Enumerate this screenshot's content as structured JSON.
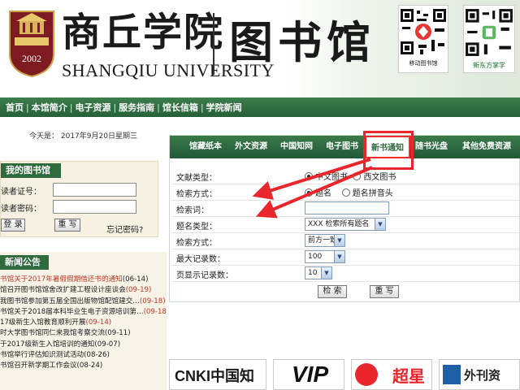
{
  "header": {
    "university_cn": "商丘学院",
    "university_en": "SHANGQIU UNIVERSITY",
    "library_cn": "图书馆",
    "crest_year": "2002",
    "qr1_caption": "移动图书馆",
    "qr2_caption": "新东方掌学"
  },
  "nav": {
    "items": [
      "首页",
      "本馆简介",
      "电子资源",
      "服务指南",
      "馆长信箱",
      "学院新闻"
    ]
  },
  "today": "今天是： 2017年9月20日星期三",
  "my_library": {
    "title": "我的图书馆",
    "reader_id_label": "读者证号：",
    "reader_pwd_label": "读者密码：",
    "login_button": "登 录",
    "reset_button": "重 写",
    "forgot_link": "忘记密码?"
  },
  "news": {
    "title": "新闻公告",
    "items": [
      {
        "title": "书馆关于2017年暑假假期借还书的通知",
        "date": "(06-14)"
      },
      {
        "title": "馆召开图书馆馆舍改扩建工程设计座谈会",
        "date": "(09-19)"
      },
      {
        "title": "我图书馆参加第五届全国出版物馆配馆建交…",
        "date": "(09-18)"
      },
      {
        "title": "书馆关于2018届本科毕业生电子资源培训第…",
        "date": "(09-18)"
      },
      {
        "title": "17级新生入馆教育顺利开展",
        "date": "(09-14)"
      },
      {
        "title": "时大学图书馆同仁来我馆考察交流",
        "date": "(09-11)"
      },
      {
        "title": "于2017级新生入馆培训的通知",
        "date": "(09-07)"
      },
      {
        "title": "书馆举行评估知识测试活动",
        "date": "(08-26)"
      },
      {
        "title": "书馆召开新学期工作会议",
        "date": "(08-24)"
      }
    ]
  },
  "search": {
    "tabs": [
      "馆藏纸本",
      "外文资源",
      "中国知网",
      "电子图书",
      "新书通知",
      "随书光盘",
      "其他免费资源"
    ],
    "active_tab": "新书通知",
    "rows": {
      "doc_type_label": "文献类型：",
      "doc_type_opt1": "中文图书",
      "doc_type_opt2": "西文图书",
      "method_label": "检索方式：",
      "method_opt1": "题名",
      "method_opt2": "题名拼音头",
      "term_label": "检索词：",
      "title_type_label": "题名类型：",
      "title_type_value": "XXX 检索所有题名",
      "search_mode_label": "检索方式：",
      "search_mode_value": "前方一致",
      "max_records_label": "最大记录数：",
      "max_records_value": "100",
      "per_page_label": "页显示记录数：",
      "per_page_value": "10"
    },
    "search_button": "检 索",
    "reset_button": "重 写"
  },
  "logos": {
    "cnki": "CNKI中国知网",
    "vip": "VIP",
    "chaoxing": "超星",
    "foreign": "外刊资"
  },
  "colors": {
    "nav_green": "#2f6b3d",
    "highlight_red": "#e8262c",
    "news_date_red": "#c0392b"
  }
}
